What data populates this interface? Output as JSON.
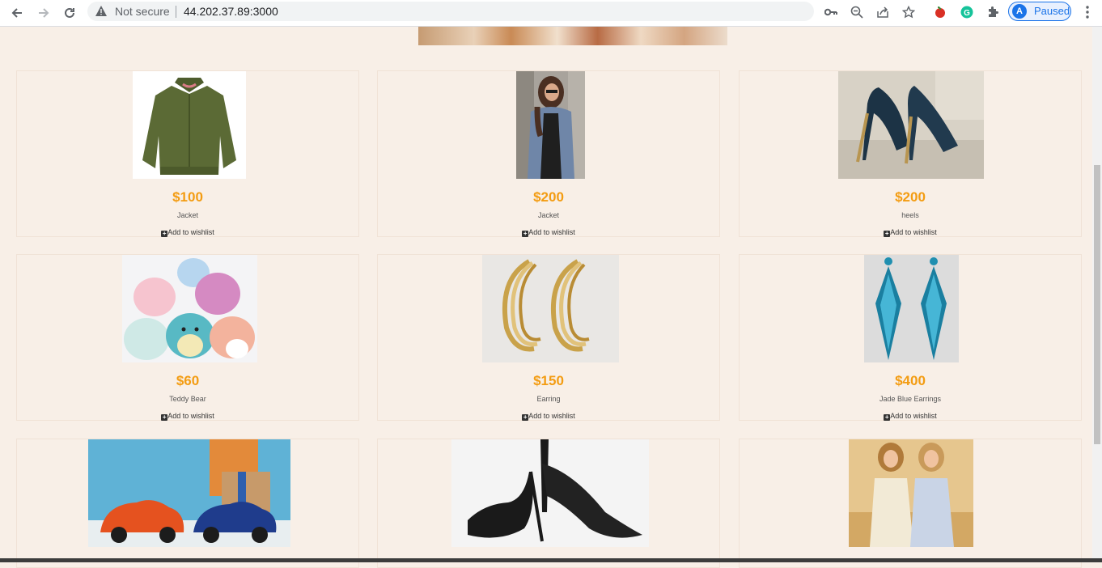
{
  "browser": {
    "security_label": "Not secure",
    "url": "44.202.37.89:3000",
    "profile_initial": "A",
    "profile_status": "Paused"
  },
  "products": [
    {
      "price": "$100",
      "name": "Jacket",
      "wishlist_label": "Add to wishlist",
      "image": "green-jacket"
    },
    {
      "price": "$200",
      "name": "Jacket",
      "wishlist_label": "Add to wishlist",
      "image": "denim-jacket"
    },
    {
      "price": "$200",
      "name": "heels",
      "wishlist_label": "Add to wishlist",
      "image": "navy-heels"
    },
    {
      "price": "$60",
      "name": "Teddy Bear",
      "wishlist_label": "Add to wishlist",
      "image": "plush-toys"
    },
    {
      "price": "$150",
      "name": "Earring",
      "wishlist_label": "Add to wishlist",
      "image": "gold-hoop-earrings"
    },
    {
      "price": "$400",
      "name": "Jade Blue Earrings",
      "wishlist_label": "Add to wishlist",
      "image": "blue-drop-earrings"
    },
    {
      "image": "toy-cars"
    },
    {
      "image": "black-heels"
    },
    {
      "image": "two-women"
    }
  ],
  "colors": {
    "page_background": "#f8efe7",
    "price": "#f39c12",
    "accent_blue": "#1a73e8"
  }
}
